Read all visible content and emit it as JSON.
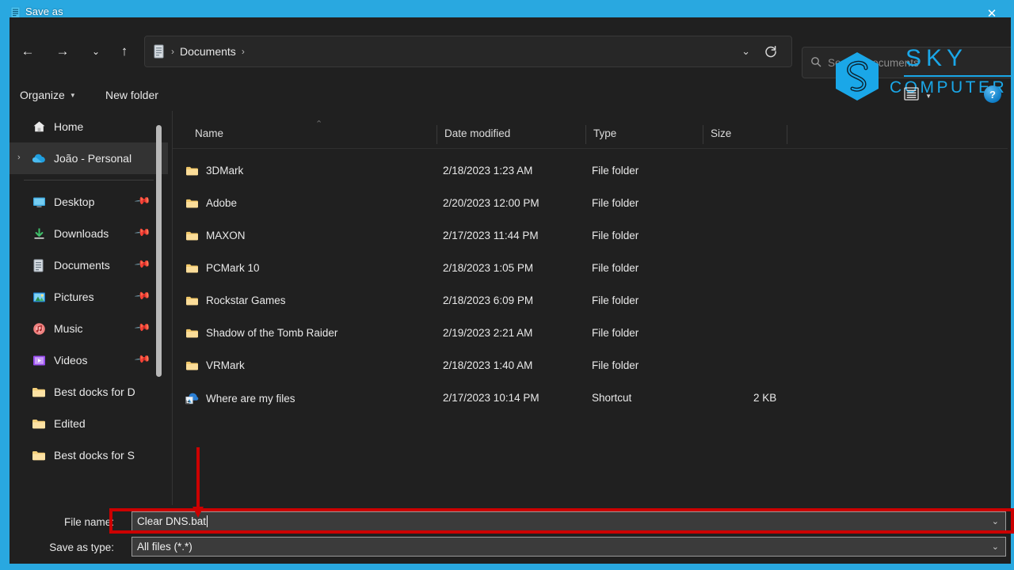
{
  "window": {
    "title": "Save as",
    "title_icon": "document-window-icon",
    "close_label": "✕",
    "accent_border": "#29a8e0"
  },
  "nav": {
    "back": "←",
    "forward": "→",
    "recent": "⌄",
    "up": "↑",
    "refresh": "⟳"
  },
  "address": {
    "icon": "documents-folder-icon",
    "separator": "›",
    "crumb": "Documents",
    "trailing_separator": "›",
    "dropdown": "⌄"
  },
  "search": {
    "icon": "search-icon",
    "placeholder": "Search Documents"
  },
  "watermark": {
    "line1": "SKY",
    "line2": "COMPUTER",
    "color": "#1aa7e8"
  },
  "commandbar": {
    "organize": "Organize",
    "organize_caret": "▼",
    "new_folder": "New folder",
    "view_icon": "list-view-icon",
    "view_caret": "▼",
    "help": "?"
  },
  "sidebar": {
    "items": [
      {
        "label": "Home",
        "icon": "home-icon",
        "pinned": false,
        "selected": false,
        "expander": ""
      },
      {
        "label": "João - Personal",
        "icon": "onedrive-icon",
        "pinned": false,
        "selected": true,
        "expander": "›"
      },
      {
        "label": "Desktop",
        "icon": "desktop-icon",
        "pinned": true,
        "selected": false,
        "expander": ""
      },
      {
        "label": "Downloads",
        "icon": "downloads-icon",
        "pinned": true,
        "selected": false,
        "expander": ""
      },
      {
        "label": "Documents",
        "icon": "documents-icon",
        "pinned": true,
        "selected": false,
        "expander": ""
      },
      {
        "label": "Pictures",
        "icon": "pictures-icon",
        "pinned": true,
        "selected": false,
        "expander": ""
      },
      {
        "label": "Music",
        "icon": "music-icon",
        "pinned": true,
        "selected": false,
        "expander": ""
      },
      {
        "label": "Videos",
        "icon": "videos-icon",
        "pinned": true,
        "selected": false,
        "expander": ""
      },
      {
        "label": "Best docks for D",
        "icon": "folder-icon",
        "pinned": false,
        "selected": false,
        "expander": ""
      },
      {
        "label": "Edited",
        "icon": "folder-icon",
        "pinned": false,
        "selected": false,
        "expander": ""
      },
      {
        "label": "Best docks for S",
        "icon": "folder-icon",
        "pinned": false,
        "selected": false,
        "expander": ""
      }
    ]
  },
  "filelist": {
    "columns": [
      "Name",
      "Date modified",
      "Type",
      "Size"
    ],
    "sort_indicator": "⌃",
    "rows": [
      {
        "name": "3DMark",
        "date": "2/18/2023 1:23 AM",
        "type": "File folder",
        "size": "",
        "icon": "folder-icon"
      },
      {
        "name": "Adobe",
        "date": "2/20/2023 12:00 PM",
        "type": "File folder",
        "size": "",
        "icon": "folder-icon"
      },
      {
        "name": "MAXON",
        "date": "2/17/2023 11:44 PM",
        "type": "File folder",
        "size": "",
        "icon": "folder-icon"
      },
      {
        "name": "PCMark 10",
        "date": "2/18/2023 1:05 PM",
        "type": "File folder",
        "size": "",
        "icon": "folder-icon"
      },
      {
        "name": "Rockstar Games",
        "date": "2/18/2023 6:09 PM",
        "type": "File folder",
        "size": "",
        "icon": "folder-icon"
      },
      {
        "name": "Shadow of the Tomb Raider",
        "date": "2/19/2023 2:21 AM",
        "type": "File folder",
        "size": "",
        "icon": "folder-icon"
      },
      {
        "name": "VRMark",
        "date": "2/18/2023 1:40 AM",
        "type": "File folder",
        "size": "",
        "icon": "folder-icon"
      },
      {
        "name": "Where are my files",
        "date": "2/17/2023 10:14 PM",
        "type": "Shortcut",
        "size": "2 KB",
        "icon": "shortcut-icon"
      }
    ]
  },
  "form": {
    "filename_label": "File name:",
    "filename_value": "Clear DNS.bat",
    "filetype_label": "Save as type:",
    "filetype_value": "All files  (*.*)",
    "dropdown_caret": "⌄"
  },
  "annotation": {
    "color": "#cc0000",
    "target": "filename-field"
  }
}
